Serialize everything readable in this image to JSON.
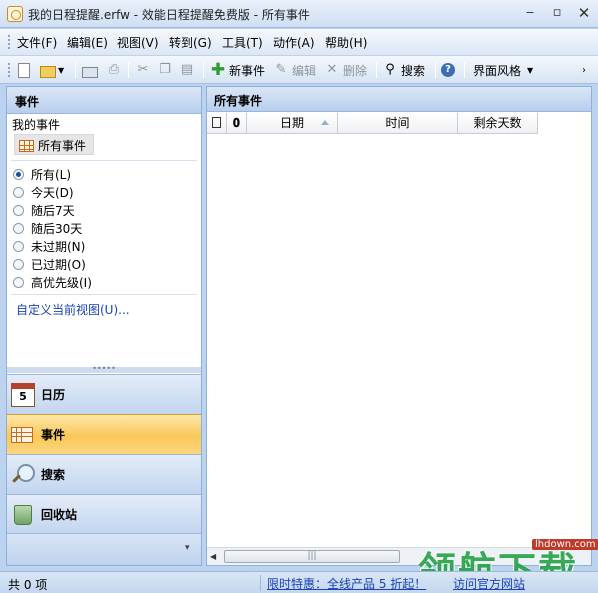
{
  "window": {
    "title": "我的日程提醒.erfw - 效能日程提醒免费版 - 所有事件"
  },
  "menu": [
    "文件(F)",
    "编辑(E)",
    "视图(V)",
    "转到(G)",
    "工具(T)",
    "动作(A)",
    "帮助(H)"
  ],
  "toolbar": {
    "new_event": "新事件",
    "edit": "编辑",
    "delete": "删除",
    "search": "搜索",
    "skin": "界面风格"
  },
  "left_panel": {
    "header": "事件",
    "my_events": "我的事件",
    "all_events": "所有事件",
    "filters": [
      "所有(L)",
      "今天(D)",
      "随后7天",
      "随后30天",
      "未过期(N)",
      "已过期(O)",
      "高优先级(I)"
    ],
    "selected_filter": "所有(L)",
    "customize_link": "自定义当前视图(U)...",
    "nav": [
      {
        "label": "日历",
        "icon": "calendar-icon",
        "badge": "5"
      },
      {
        "label": "事件",
        "icon": "events-grid-icon",
        "active": true
      },
      {
        "label": "搜索",
        "icon": "magnifier-icon"
      },
      {
        "label": "回收站",
        "icon": "recycle-bin-icon"
      }
    ]
  },
  "right_panel": {
    "header": "所有事件",
    "columns": [
      "日期",
      "时间",
      "剩余天数"
    ]
  },
  "status": {
    "count": "共 0 项",
    "promo": "限时特惠：全线产品 5 折起！",
    "promo2": "访问官方网站"
  },
  "watermark": {
    "brand": "领航下载",
    "url": "lhdown.com"
  },
  "colors": {
    "accent": "#f9c75a",
    "header": "#b8cfee",
    "link": "#1a43b8"
  }
}
